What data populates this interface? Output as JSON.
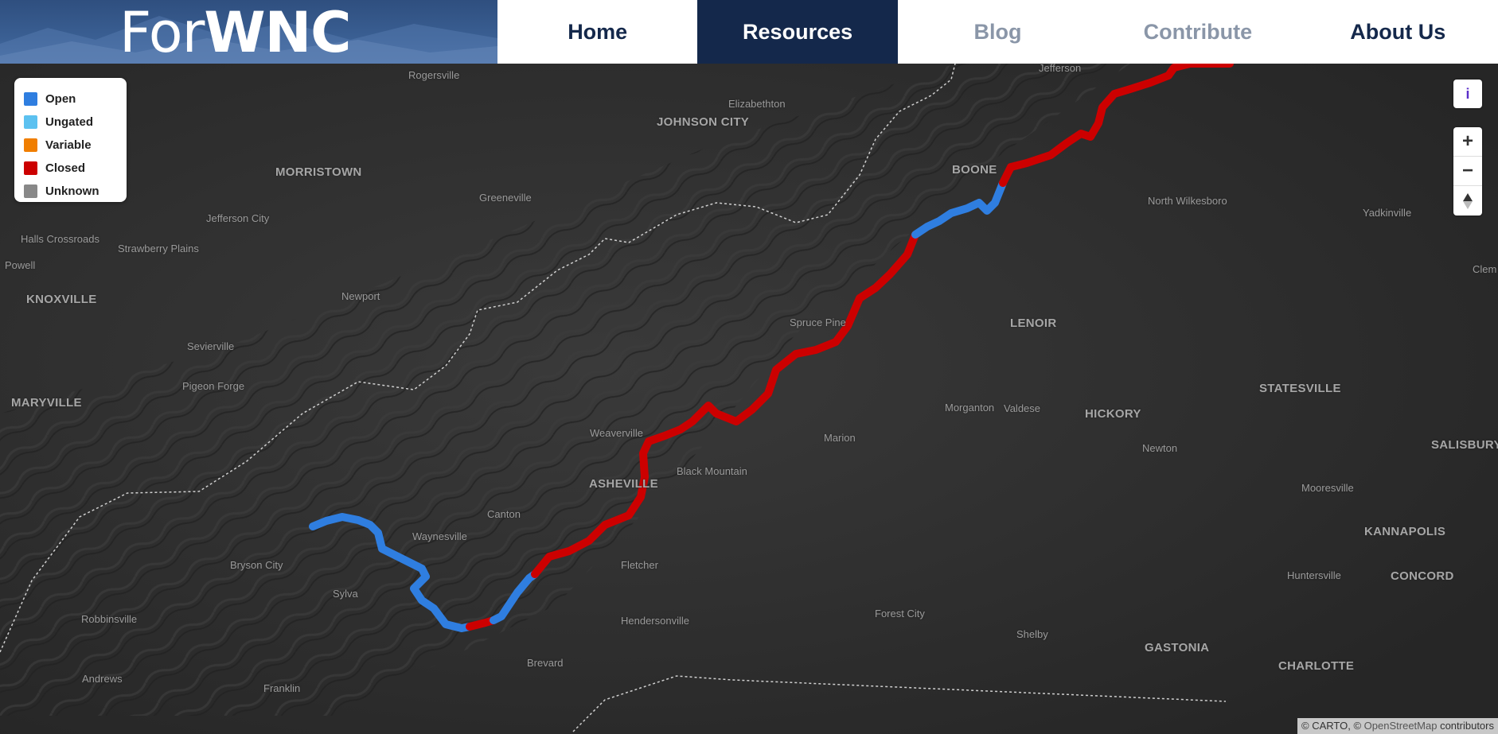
{
  "brand": {
    "prefix": "For",
    "suffix": "WNC"
  },
  "nav": {
    "home": "Home",
    "resources": "Resources",
    "blog": "Blog",
    "contribute": "Contribute",
    "about": "About Us"
  },
  "legend": {
    "items": [
      {
        "label": "Open",
        "color": "#2f7ee0"
      },
      {
        "label": "Ungated",
        "color": "#5cc1f0"
      },
      {
        "label": "Variable",
        "color": "#f07e00"
      },
      {
        "label": "Closed",
        "color": "#cc0000"
      },
      {
        "label": "Unknown",
        "color": "#888888"
      }
    ]
  },
  "controls": {
    "info": "i",
    "zoom_in": "+",
    "zoom_out": "−"
  },
  "attribution": {
    "prefix": "© CARTO, © ",
    "osm": "OpenStreetMap",
    "suffix": " contributors"
  },
  "places": {
    "rogersville": "Rogersville",
    "jefferson": "Jefferson",
    "elizabethton": "Elizabethton",
    "johnson_city": "JOHNSON CITY",
    "morristown": "MORRISTOWN",
    "greeneville": "Greeneville",
    "boone": "BOONE",
    "north_wilkesboro": "North Wilkesboro",
    "yadkinville": "Yadkinville",
    "jefferson_city": "Jefferson City",
    "halls_crossroads": "Halls Crossroads",
    "strawberry_plains": "Strawberry Plains",
    "powell": "Powell",
    "clemmons": "Clem",
    "knoxville": "KNOXVILLE",
    "newport": "Newport",
    "spruce_pine": "Spruce Pine",
    "lenoir": "LENOIR",
    "sevierville": "Sevierville",
    "pigeon_forge": "Pigeon Forge",
    "statesville": "STATESVILLE",
    "maryville": "MARYVILLE",
    "morganton": "Morganton",
    "valdese": "Valdese",
    "hickory": "HICKORY",
    "weaverville": "Weaverville",
    "marion": "Marion",
    "newton": "Newton",
    "salisbury": "SALISBURY",
    "black_mountain": "Black Mountain",
    "asheville": "ASHEVILLE",
    "mooresville": "Mooresville",
    "canton": "Canton",
    "waynesville": "Waynesville",
    "kannapolis": "KANNAPOLIS",
    "bryson_city": "Bryson City",
    "fletcher": "Fletcher",
    "huntersville": "Huntersville",
    "concord": "CONCORD",
    "sylva": "Sylva",
    "forest_city": "Forest City",
    "robbinsville": "Robbinsville",
    "hendersonville": "Hendersonville",
    "shelby": "Shelby",
    "gastonia": "GASTONIA",
    "brevard": "Brevard",
    "charlotte": "CHARLOTTE",
    "andrews": "Andrews",
    "franklin": "Franklin"
  }
}
